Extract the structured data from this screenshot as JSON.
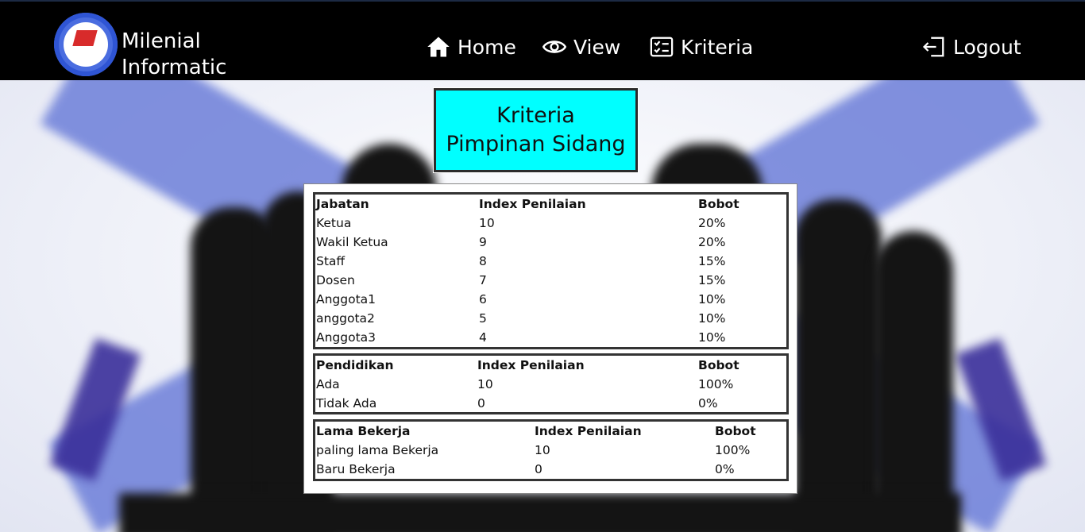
{
  "brand": {
    "line1": "Milenial",
    "line2": "Informatic"
  },
  "nav": {
    "home": "Home",
    "view": "View",
    "kriteria": "Kriteria",
    "logout": "Logout"
  },
  "title": {
    "line1": "Kriteria",
    "line2": "Pimpinan Sidang"
  },
  "tables": [
    {
      "headers": [
        "Jabatan",
        "Index Penilaian",
        "Bobot"
      ],
      "rows": [
        [
          "Ketua",
          "10",
          "20%"
        ],
        [
          "Wakil Ketua",
          "9",
          "20%"
        ],
        [
          "Staff",
          "8",
          "15%"
        ],
        [
          "Dosen",
          "7",
          "15%"
        ],
        [
          "Anggota1",
          "6",
          "10%"
        ],
        [
          "anggota2",
          "5",
          "10%"
        ],
        [
          "Anggota3",
          "4",
          "10%"
        ]
      ]
    },
    {
      "headers": [
        "Pendidikan",
        "Index Penilaian",
        "Bobot"
      ],
      "rows": [
        [
          "Ada",
          "10",
          "100%"
        ],
        [
          "Tidak Ada",
          "0",
          "0%"
        ]
      ]
    },
    {
      "headers": [
        "Lama Bekerja",
        "Index Penilaian",
        "Bobot"
      ],
      "rows": [
        [
          "paling lama Bekerja",
          "10",
          "100%"
        ],
        [
          "Baru Bekerja",
          "0",
          "0%"
        ]
      ]
    }
  ],
  "colors": {
    "topbar": "#000000",
    "title_bg": "#00ffff",
    "panel_border": "#333333"
  },
  "icons": {
    "home": "home-icon",
    "view": "eye-icon",
    "kriteria": "checklist-icon",
    "logout": "logout-icon"
  }
}
